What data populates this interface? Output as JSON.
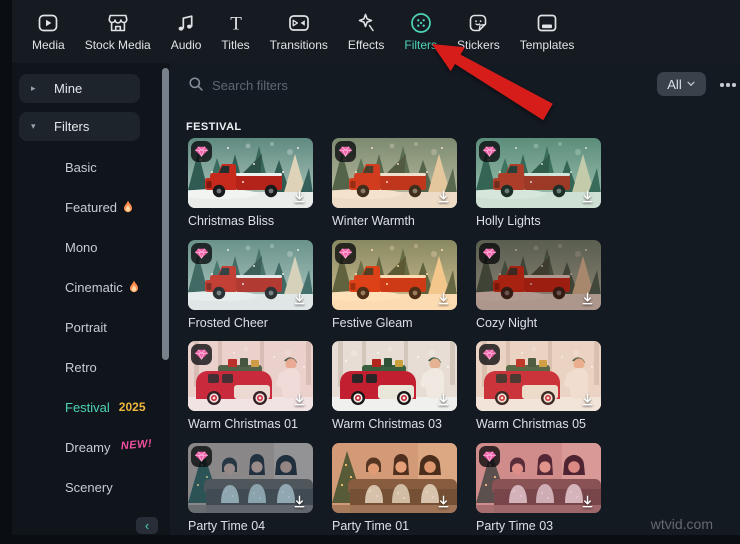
{
  "colors": {
    "accent": "#4ed4b6",
    "arrow": "#d61d1a",
    "badge_gold": "#f0b73e",
    "badge_pink": "#f04fa0",
    "gem_pink": "#f25fa8"
  },
  "toolbar": {
    "tabs": [
      {
        "label": "Media",
        "icon": "media-icon"
      },
      {
        "label": "Stock Media",
        "icon": "stock-media-icon"
      },
      {
        "label": "Audio",
        "icon": "audio-icon"
      },
      {
        "label": "Titles",
        "icon": "titles-icon"
      },
      {
        "label": "Transitions",
        "icon": "transitions-icon"
      },
      {
        "label": "Effects",
        "icon": "effects-icon"
      },
      {
        "label": "Filters",
        "icon": "filters-icon",
        "active": true
      },
      {
        "label": "Stickers",
        "icon": "stickers-icon"
      },
      {
        "label": "Templates",
        "icon": "templates-icon"
      }
    ]
  },
  "sidebar": {
    "groups": [
      {
        "label": "Mine",
        "state": "collapsed"
      },
      {
        "label": "Filters",
        "state": "expanded"
      }
    ],
    "items": [
      {
        "label": "Basic"
      },
      {
        "label": "Featured",
        "badge_icon": "flame-icon"
      },
      {
        "label": "Mono"
      },
      {
        "label": "Cinematic",
        "badge_icon": "flame-icon"
      },
      {
        "label": "Portrait"
      },
      {
        "label": "Retro"
      },
      {
        "label": "Festival",
        "badge_text": "2025",
        "badge_style": "gold",
        "active": true
      },
      {
        "label": "Dreamy",
        "badge_text": "NEW!",
        "badge_style": "pink"
      },
      {
        "label": "Scenery"
      }
    ]
  },
  "search": {
    "placeholder": "Search filters"
  },
  "filter_dropdown": {
    "value": "All"
  },
  "more_menu": {
    "icon": "ellipsis-icon"
  },
  "section": {
    "title": "FESTIVAL"
  },
  "grid": {
    "items": [
      {
        "label": "Christmas Bliss",
        "pro": true,
        "scene": "truck",
        "grade": "bliss"
      },
      {
        "label": "Winter Warmth",
        "pro": true,
        "scene": "truck",
        "grade": "warmth"
      },
      {
        "label": "Holly Lights",
        "pro": true,
        "scene": "truck",
        "grade": "holly"
      },
      {
        "label": "Frosted Cheer",
        "pro": true,
        "scene": "truck",
        "grade": "frosted"
      },
      {
        "label": "Festive Gleam",
        "pro": true,
        "scene": "truck",
        "grade": "gleam"
      },
      {
        "label": "Cozy Night",
        "pro": true,
        "scene": "truck",
        "grade": "cozy"
      },
      {
        "label": "Warm Christmas 01",
        "pro": true,
        "scene": "car",
        "grade": "wc01"
      },
      {
        "label": "Warm Christmas 03",
        "pro": false,
        "scene": "car",
        "grade": "wc03"
      },
      {
        "label": "Warm Christmas 05",
        "pro": true,
        "scene": "car",
        "grade": "wc05"
      },
      {
        "label": "Party Time 04",
        "pro": true,
        "scene": "party",
        "grade": "pt04"
      },
      {
        "label": "Party Time 01",
        "pro": false,
        "scene": "party",
        "grade": "pt01"
      },
      {
        "label": "Party Time 03",
        "pro": true,
        "scene": "party",
        "grade": "pt03"
      }
    ]
  },
  "watermark": "wtvid.com"
}
